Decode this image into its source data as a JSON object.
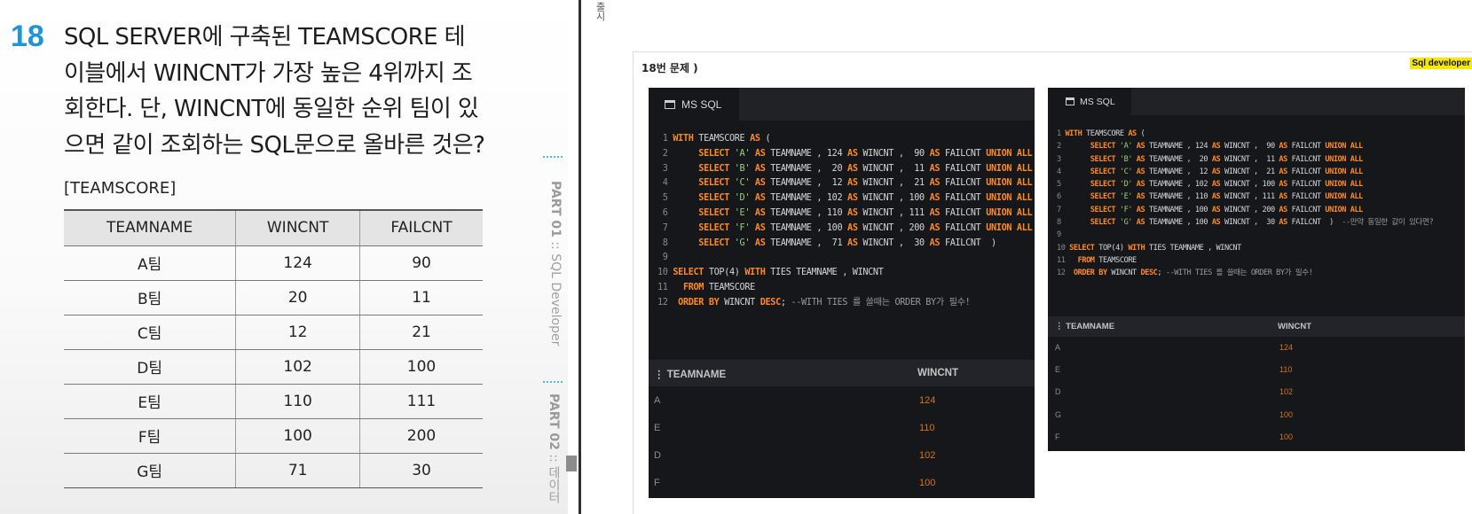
{
  "book": {
    "question_number": "18",
    "question_lines": [
      "SQL SERVER에 구축된 TEAMSCORE 테",
      "이블에서 WINCNT가 가장 높은 4위까지 조",
      "회한다. 단, WINCNT에 동일한 순위 팀이 있",
      "으면 같이 조회하는 SQL문으로 올바른 것은?"
    ],
    "table_title": "[TEAMSCORE]",
    "table_headers": [
      "TEAMNAME",
      "WINCNT",
      "FAILCNT"
    ],
    "table_rows": [
      [
        "A팀",
        "124",
        "90"
      ],
      [
        "B팀",
        "20",
        "11"
      ],
      [
        "C팀",
        "12",
        "21"
      ],
      [
        "D팀",
        "102",
        "100"
      ],
      [
        "E팀",
        "110",
        "111"
      ],
      [
        "F팀",
        "100",
        "200"
      ],
      [
        "G팀",
        "71",
        "30"
      ]
    ],
    "side_part1_prefix": "PART 01",
    "side_part1_rest": " :: SQL Developer",
    "side_part2_prefix": "PART 02",
    "side_part2_rest": " :: 데이터",
    "top_edge_text": "출시"
  },
  "slide": {
    "title": "18번 문제 )",
    "brand": "Sql developer"
  },
  "panel_large": {
    "tab_label": "MS SQL",
    "result_headers": [
      "TEAMNAME",
      "WINCNT"
    ],
    "result_rows": [
      [
        "A",
        "124"
      ],
      [
        "E",
        "110"
      ],
      [
        "D",
        "102"
      ],
      [
        "F",
        "100"
      ]
    ]
  },
  "panel_small": {
    "tab_label": "MS SQL",
    "result_headers": [
      "TEAMNAME",
      "WINCNT"
    ],
    "result_rows": [
      [
        "A",
        "124"
      ],
      [
        "E",
        "110"
      ],
      [
        "D",
        "102"
      ],
      [
        "G",
        "100"
      ],
      [
        "F",
        "100"
      ]
    ]
  },
  "code_large": [
    [
      [
        "n",
        " 1 "
      ],
      [
        "k",
        "WITH"
      ],
      [
        "t",
        " TEAMSCORE "
      ],
      [
        "k",
        "AS"
      ],
      [
        "t",
        " ("
      ]
    ],
    [
      [
        "n",
        " 2 "
      ],
      [
        "t",
        "     "
      ],
      [
        "k",
        "SELECT"
      ],
      [
        "s",
        " 'A' "
      ],
      [
        "k",
        "AS"
      ],
      [
        "t",
        " TEAMNAME , 124 "
      ],
      [
        "k",
        "AS"
      ],
      [
        "t",
        " WINCNT ,  90 "
      ],
      [
        "k",
        "AS"
      ],
      [
        "t",
        " FAILCNT "
      ],
      [
        "k",
        "UNION ALL"
      ]
    ],
    [
      [
        "n",
        " 3 "
      ],
      [
        "t",
        "     "
      ],
      [
        "k",
        "SELECT"
      ],
      [
        "s",
        " 'B' "
      ],
      [
        "k",
        "AS"
      ],
      [
        "t",
        " TEAMNAME ,  20 "
      ],
      [
        "k",
        "AS"
      ],
      [
        "t",
        " WINCNT ,  11 "
      ],
      [
        "k",
        "AS"
      ],
      [
        "t",
        " FAILCNT "
      ],
      [
        "k",
        "UNION ALL"
      ]
    ],
    [
      [
        "n",
        " 4 "
      ],
      [
        "t",
        "     "
      ],
      [
        "k",
        "SELECT"
      ],
      [
        "s",
        " 'C' "
      ],
      [
        "k",
        "AS"
      ],
      [
        "t",
        " TEAMNAME ,  12 "
      ],
      [
        "k",
        "AS"
      ],
      [
        "t",
        " WINCNT ,  21 "
      ],
      [
        "k",
        "AS"
      ],
      [
        "t",
        " FAILCNT "
      ],
      [
        "k",
        "UNION ALL"
      ]
    ],
    [
      [
        "n",
        " 5 "
      ],
      [
        "t",
        "     "
      ],
      [
        "k",
        "SELECT"
      ],
      [
        "s",
        " 'D' "
      ],
      [
        "k",
        "AS"
      ],
      [
        "t",
        " TEAMNAME , 102 "
      ],
      [
        "k",
        "AS"
      ],
      [
        "t",
        " WINCNT , 100 "
      ],
      [
        "k",
        "AS"
      ],
      [
        "t",
        " FAILCNT "
      ],
      [
        "k",
        "UNION ALL"
      ]
    ],
    [
      [
        "n",
        " 6 "
      ],
      [
        "t",
        "     "
      ],
      [
        "k",
        "SELECT"
      ],
      [
        "s",
        " 'E' "
      ],
      [
        "k",
        "AS"
      ],
      [
        "t",
        " TEAMNAME , 110 "
      ],
      [
        "k",
        "AS"
      ],
      [
        "t",
        " WINCNT , 111 "
      ],
      [
        "k",
        "AS"
      ],
      [
        "t",
        " FAILCNT "
      ],
      [
        "k",
        "UNION ALL"
      ]
    ],
    [
      [
        "n",
        " 7 "
      ],
      [
        "t",
        "     "
      ],
      [
        "k",
        "SELECT"
      ],
      [
        "s",
        " 'F' "
      ],
      [
        "k",
        "AS"
      ],
      [
        "t",
        " TEAMNAME , 100 "
      ],
      [
        "k",
        "AS"
      ],
      [
        "t",
        " WINCNT , 200 "
      ],
      [
        "k",
        "AS"
      ],
      [
        "t",
        " FAILCNT "
      ],
      [
        "k",
        "UNION ALL"
      ]
    ],
    [
      [
        "n",
        " 8 "
      ],
      [
        "t",
        "     "
      ],
      [
        "k",
        "SELECT"
      ],
      [
        "s",
        " 'G' "
      ],
      [
        "k",
        "AS"
      ],
      [
        "t",
        " TEAMNAME ,  71 "
      ],
      [
        "k",
        "AS"
      ],
      [
        "t",
        " WINCNT ,  30 "
      ],
      [
        "k",
        "AS"
      ],
      [
        "t",
        " FAILCNT  )"
      ]
    ],
    [
      [
        "n",
        " 9 "
      ]
    ],
    [
      [
        "n",
        "10 "
      ],
      [
        "k",
        "SELECT"
      ],
      [
        "t",
        " TOP(4) "
      ],
      [
        "k",
        "WITH"
      ],
      [
        "t",
        " TIES TEAMNAME , WINCNT"
      ]
    ],
    [
      [
        "n",
        "11 "
      ],
      [
        "t",
        "  "
      ],
      [
        "k",
        "FROM"
      ],
      [
        "t",
        " TEAMSCORE"
      ]
    ],
    [
      [
        "n",
        "12 "
      ],
      [
        "t",
        " "
      ],
      [
        "k",
        "ORDER BY"
      ],
      [
        "t",
        " WINCNT "
      ],
      [
        "k",
        "DESC"
      ],
      [
        "t",
        "; "
      ],
      [
        "c",
        "--WITH TIES 를 쓸때는 ORDER BY가 필수!"
      ]
    ]
  ],
  "code_small": [
    [
      [
        "n",
        "1 "
      ],
      [
        "k",
        "WITH"
      ],
      [
        "t",
        " TEAMSCORE "
      ],
      [
        "k",
        "AS"
      ],
      [
        "t",
        " ("
      ]
    ],
    [
      [
        "n",
        "2 "
      ],
      [
        "t",
        "      "
      ],
      [
        "k",
        "SELECT"
      ],
      [
        "s",
        " 'A' "
      ],
      [
        "k",
        "AS"
      ],
      [
        "t",
        " TEAMNAME , 124 "
      ],
      [
        "k",
        "AS"
      ],
      [
        "t",
        " WINCNT ,  90 "
      ],
      [
        "k",
        "AS"
      ],
      [
        "t",
        " FAILCNT "
      ],
      [
        "k",
        "UNION ALL"
      ]
    ],
    [
      [
        "n",
        "3 "
      ],
      [
        "t",
        "      "
      ],
      [
        "k",
        "SELECT"
      ],
      [
        "s",
        " 'B' "
      ],
      [
        "k",
        "AS"
      ],
      [
        "t",
        " TEAMNAME ,  20 "
      ],
      [
        "k",
        "AS"
      ],
      [
        "t",
        " WINCNT ,  11 "
      ],
      [
        "k",
        "AS"
      ],
      [
        "t",
        " FAILCNT "
      ],
      [
        "k",
        "UNION ALL"
      ]
    ],
    [
      [
        "n",
        "4 "
      ],
      [
        "t",
        "      "
      ],
      [
        "k",
        "SELECT"
      ],
      [
        "s",
        " 'C' "
      ],
      [
        "k",
        "AS"
      ],
      [
        "t",
        " TEAMNAME ,  12 "
      ],
      [
        "k",
        "AS"
      ],
      [
        "t",
        " WINCNT ,  21 "
      ],
      [
        "k",
        "AS"
      ],
      [
        "t",
        " FAILCNT "
      ],
      [
        "k",
        "UNION ALL"
      ]
    ],
    [
      [
        "n",
        "5 "
      ],
      [
        "t",
        "      "
      ],
      [
        "k",
        "SELECT"
      ],
      [
        "s",
        " 'D' "
      ],
      [
        "k",
        "AS"
      ],
      [
        "t",
        " TEAMNAME , 102 "
      ],
      [
        "k",
        "AS"
      ],
      [
        "t",
        " WINCNT , 100 "
      ],
      [
        "k",
        "AS"
      ],
      [
        "t",
        " FAILCNT "
      ],
      [
        "k",
        "UNION ALL"
      ]
    ],
    [
      [
        "n",
        "6 "
      ],
      [
        "t",
        "      "
      ],
      [
        "k",
        "SELECT"
      ],
      [
        "s",
        " 'E' "
      ],
      [
        "k",
        "AS"
      ],
      [
        "t",
        " TEAMNAME , 110 "
      ],
      [
        "k",
        "AS"
      ],
      [
        "t",
        " WINCNT , 111 "
      ],
      [
        "k",
        "AS"
      ],
      [
        "t",
        " FAILCNT "
      ],
      [
        "k",
        "UNION ALL"
      ]
    ],
    [
      [
        "n",
        "7 "
      ],
      [
        "t",
        "      "
      ],
      [
        "k",
        "SELECT"
      ],
      [
        "s",
        " 'F' "
      ],
      [
        "k",
        "AS"
      ],
      [
        "t",
        " TEAMNAME , 100 "
      ],
      [
        "k",
        "AS"
      ],
      [
        "t",
        " WINCNT , 200 "
      ],
      [
        "k",
        "AS"
      ],
      [
        "t",
        " FAILCNT "
      ],
      [
        "k",
        "UNION ALL"
      ]
    ],
    [
      [
        "n",
        "8 "
      ],
      [
        "t",
        "      "
      ],
      [
        "k",
        "SELECT"
      ],
      [
        "s",
        " 'G' "
      ],
      [
        "k",
        "AS"
      ],
      [
        "t",
        " TEAMNAME , 100 "
      ],
      [
        "k",
        "AS"
      ],
      [
        "t",
        " WINCNT ,  30 "
      ],
      [
        "k",
        "AS"
      ],
      [
        "t",
        " FAILCNT  )  "
      ],
      [
        "c",
        "--만약 동일한 값이 있다면?"
      ]
    ],
    [
      [
        "n",
        "9 "
      ]
    ],
    [
      [
        "n",
        "10 "
      ],
      [
        "k",
        "SELECT"
      ],
      [
        "t",
        " TOP(4) "
      ],
      [
        "k",
        "WITH"
      ],
      [
        "t",
        " TIES TEAMNAME , WINCNT"
      ]
    ],
    [
      [
        "n",
        "11 "
      ],
      [
        "t",
        "  "
      ],
      [
        "k",
        "FROM"
      ],
      [
        "t",
        " TEAMSCORE"
      ]
    ],
    [
      [
        "n",
        "12 "
      ],
      [
        "t",
        " "
      ],
      [
        "k",
        "ORDER BY"
      ],
      [
        "t",
        " WINCNT "
      ],
      [
        "k",
        "DESC"
      ],
      [
        "t",
        "; "
      ],
      [
        "c",
        "--WITH TIES 를 쓸때는 ORDER BY가 필수!"
      ]
    ]
  ]
}
